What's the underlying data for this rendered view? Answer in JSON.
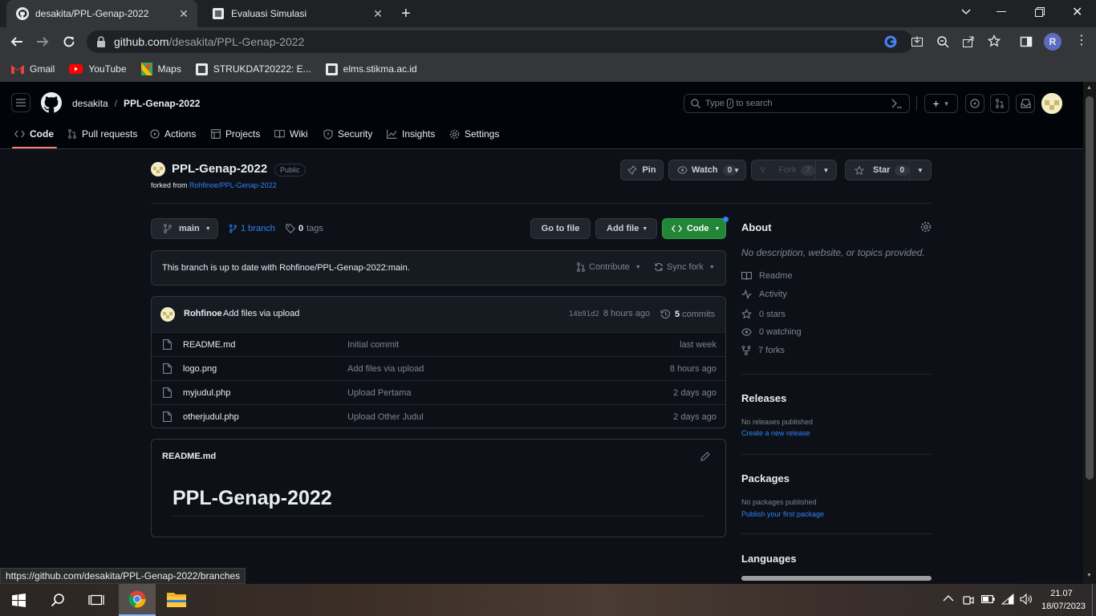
{
  "browser": {
    "tabs": [
      {
        "title": "desakita/PPL-Genap-2022",
        "active": true
      },
      {
        "title": "Evaluasi Simulasi",
        "active": false
      }
    ],
    "url_host": "github.com",
    "url_path": "/desakita/PPL-Genap-2022",
    "profile_initial": "R",
    "bookmarks": [
      "Gmail",
      "YouTube",
      "Maps",
      "STRUKDAT20222: E...",
      "elms.stikma.ac.id"
    ],
    "status_url": "https://github.com/desakita/PPL-Genap-2022/branches"
  },
  "github": {
    "owner": "desakita",
    "repo": "PPL-Genap-2022",
    "search_placeholder_prefix": "Type",
    "search_key": "/",
    "search_placeholder_suffix": "to search",
    "nav_tabs": [
      "Code",
      "Pull requests",
      "Actions",
      "Projects",
      "Wiki",
      "Security",
      "Insights",
      "Settings"
    ],
    "visibility": "Public",
    "forked_from_prefix": "forked from",
    "forked_from": "Rohfinoe/PPL-Genap-2022",
    "pin_label": "Pin",
    "watch_label": "Watch",
    "watch_count": "0",
    "fork_label": "Fork",
    "fork_count": "7",
    "star_label": "Star",
    "star_count": "0",
    "branch": "main",
    "branches_label": "1 branch",
    "tags_count": "0",
    "tags_label": "tags",
    "go_to_file": "Go to file",
    "add_file": "Add file",
    "code_button": "Code",
    "sync_message": "This branch is up to date with Rohfinoe/PPL-Genap-2022:main.",
    "contribute": "Contribute",
    "sync_fork": "Sync fork",
    "commit": {
      "author": "Rohfinoe",
      "message": "Add files via upload",
      "sha": "14b91d2",
      "age": "8 hours ago",
      "count": "5",
      "count_label": "commits"
    },
    "files": [
      {
        "name": "README.md",
        "message": "Initial commit",
        "age": "last week"
      },
      {
        "name": "logo.png",
        "message": "Add files via upload",
        "age": "8 hours ago"
      },
      {
        "name": "myjudul.php",
        "message": "Upload Pertama",
        "age": "2 days ago"
      },
      {
        "name": "otherjudul.php",
        "message": "Upload Other Judul",
        "age": "2 days ago"
      }
    ],
    "readme": {
      "filename": "README.md",
      "heading": "PPL-Genap-2022"
    },
    "about": {
      "title": "About",
      "description": "No description, website, or topics provided.",
      "items": [
        "Readme",
        "Activity",
        "0 stars",
        "0 watching",
        "7 forks"
      ]
    },
    "releases": {
      "title": "Releases",
      "text": "No releases published",
      "link": "Create a new release"
    },
    "packages": {
      "title": "Packages",
      "text": "No packages published",
      "link": "Publish your first package"
    },
    "languages": {
      "title": "Languages"
    }
  },
  "taskbar": {
    "time": "21.07",
    "date": "18/07/2023"
  },
  "colors": {
    "accent_green": "#238636",
    "link_blue": "#2f81f7",
    "tab_underline": "#f78166"
  }
}
